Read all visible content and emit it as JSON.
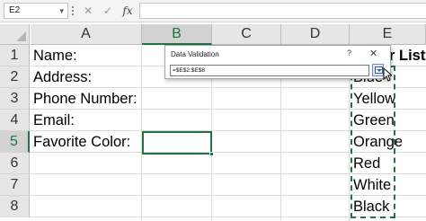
{
  "formula_bar": {
    "name_box": "E2",
    "name_box_dropdown": "▾",
    "cancel_glyph": "✕",
    "enter_glyph": "✓",
    "fx_label": "fx",
    "formula": ""
  },
  "columns": [
    "A",
    "B",
    "C",
    "D",
    "E"
  ],
  "rows": [
    "1",
    "2",
    "3",
    "4",
    "5",
    "6",
    "7",
    "8"
  ],
  "selected_column": "B",
  "selected_row": "5",
  "cells": {
    "a1": "Name:",
    "a2": "Address:",
    "a3": "Phone Number:",
    "a4": "Email:",
    "a5": "Favorite Color:",
    "e1": "r List",
    "e2": "Blue",
    "e3": "Yellow",
    "e4": "Green",
    "e5": "Orange",
    "e6": "Red",
    "e7": "White",
    "e8": "Black"
  },
  "dialog": {
    "title": "Data Validation",
    "help": "?",
    "close": "✕",
    "range_value": "=$E$2:$E$8"
  },
  "colors": {
    "accent": "#217346",
    "header_bg": "#e6e6e6",
    "gridline": "#dadada"
  }
}
